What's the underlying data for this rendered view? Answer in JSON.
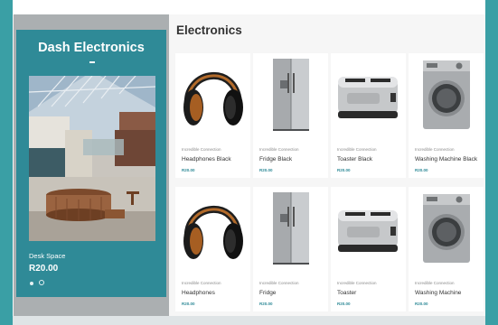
{
  "feature": {
    "title": "Dash Electronics",
    "item_name": "Desk Space",
    "item_price": "R20.00"
  },
  "section_title": "Electronics",
  "products": [
    {
      "brand": "Incredible Connection",
      "name": "Headphones Black",
      "price": "R20.00",
      "icon": "headphones-icon"
    },
    {
      "brand": "Incredible Connection",
      "name": "Fridge Black",
      "price": "R20.00",
      "icon": "fridge-icon"
    },
    {
      "brand": "Incredible Connection",
      "name": "Toaster Black",
      "price": "R20.00",
      "icon": "toaster-icon"
    },
    {
      "brand": "Incredible Connection",
      "name": "Washing Machine Black",
      "price": "R20.00",
      "icon": "washing-machine-icon"
    },
    {
      "brand": "Incredible Connection",
      "name": "Headphones",
      "price": "R20.00",
      "icon": "headphones-icon"
    },
    {
      "brand": "Incredible Connection",
      "name": "Fridge",
      "price": "R20.00",
      "icon": "fridge-icon"
    },
    {
      "brand": "Incredible Connection",
      "name": "Toaster",
      "price": "R20.00",
      "icon": "toaster-icon"
    },
    {
      "brand": "Incredible Connection",
      "name": "Washing Machine",
      "price": "R20.00",
      "icon": "washing-machine-icon"
    }
  ],
  "colors": {
    "accent": "#2f8a97",
    "background": "#5bb3b3"
  }
}
